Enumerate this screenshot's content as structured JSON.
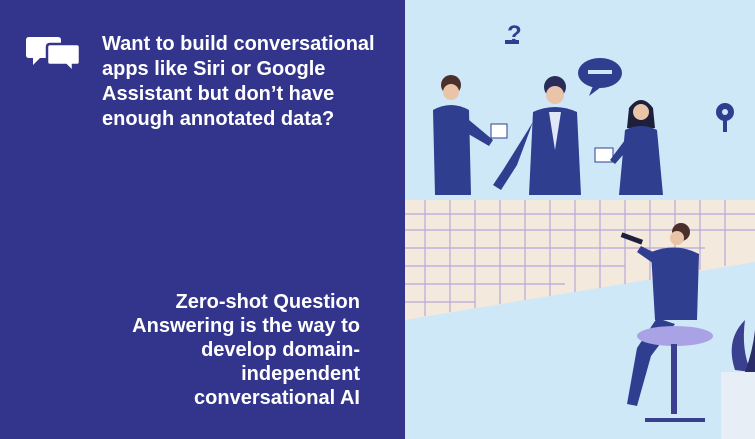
{
  "slide": {
    "headline": "Want to build conversational apps like Siri or Google Assistant but don’t have enough annotated data?",
    "tagline": "Zero-shot Question Answering is the way to develop domain-independent conversational AI"
  },
  "icons": {
    "left": "chat-bubbles-icon",
    "illustration": "business-team-illustration"
  },
  "colors": {
    "left_panel": "#33358c",
    "right_background": "#cfe8f8",
    "text": "#ffffff",
    "suit": "#2f3e8f",
    "table": "#f3e9dc"
  }
}
